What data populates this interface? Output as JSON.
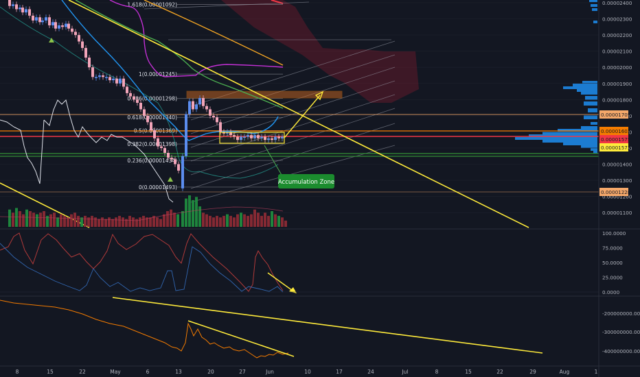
{
  "chart_data": [
    {
      "type": "candlestick",
      "title": "",
      "price_axis": {
        "ticks": [
          "0.00002400",
          "0.00002300",
          "0.00002200",
          "0.00002100",
          "0.00002000",
          "0.00001900",
          "0.00001800",
          "0.00001700",
          "0.00001600",
          "0.00001500",
          "0.00001400",
          "0.00001300",
          "0.00001200",
          "0.00001100"
        ],
        "range": [
          1.06e-05,
          2.41e-05
        ]
      },
      "price_tags": [
        {
          "value": "0.00001705",
          "price": 1.705e-05,
          "bg": "#f5a86a"
        },
        {
          "value": "0.00001602",
          "price": 1.602e-05,
          "bg": "#f57c00"
        },
        {
          "value": "0.00001575",
          "price": 1.575e-05,
          "bg": "#f23645"
        },
        {
          "value": "0.00001573",
          "price": 1.573e-05,
          "bg": "#ffeb3b"
        },
        {
          "value": "0.00001228",
          "price": 1.228e-05,
          "bg": "#f5a86a"
        }
      ],
      "fib_levels": [
        {
          "label": "1.618(0.00001092)",
          "ratio": 1.618,
          "price": 2.39e-05
        },
        {
          "label": "1(0.00001245)",
          "ratio": 1,
          "price": 1.958e-05
        },
        {
          "label": "0.786(0.00001298)",
          "ratio": 0.786,
          "price": 1.808e-05
        },
        {
          "label": "0.618(0.00001340)",
          "ratio": 0.618,
          "price": 1.69e-05
        },
        {
          "label": "0.5(0.00001369)",
          "ratio": 0.5,
          "price": 1.608e-05
        },
        {
          "label": "0.382(0.00001398)",
          "ratio": 0.382,
          "price": 1.525e-05
        },
        {
          "label": "0.236(0.00001434)",
          "ratio": 0.236,
          "price": 1.423e-05
        },
        {
          "label": "0(0.00001493)",
          "ratio": 0,
          "price": 1.258e-05
        }
      ],
      "annotations": [
        "Accumulation Zone"
      ],
      "candles": [
        {
          "x": 14,
          "o": 2.42e-05,
          "c": 2.38e-05
        },
        {
          "x": 19,
          "o": 2.38e-05,
          "c": 2.39e-05
        },
        {
          "x": 24,
          "o": 2.39e-05,
          "c": 2.36e-05
        },
        {
          "x": 29,
          "o": 2.36e-05,
          "c": 2.37e-05
        },
        {
          "x": 33,
          "o": 2.37e-05,
          "c": 2.34e-05
        },
        {
          "x": 38,
          "o": 2.34e-05,
          "c": 2.36e-05
        },
        {
          "x": 43,
          "o": 2.36e-05,
          "c": 2.32e-05
        },
        {
          "x": 48,
          "o": 2.32e-05,
          "c": 2.29e-05
        },
        {
          "x": 53,
          "o": 2.29e-05,
          "c": 2.31e-05
        },
        {
          "x": 58,
          "o": 2.31e-05,
          "c": 2.28e-05
        },
        {
          "x": 62,
          "o": 2.28e-05,
          "c": 2.29e-05
        },
        {
          "x": 67,
          "o": 2.29e-05,
          "c": 2.31e-05
        },
        {
          "x": 72,
          "o": 2.31e-05,
          "c": 2.26e-05
        },
        {
          "x": 77,
          "o": 2.26e-05,
          "c": 2.28e-05
        },
        {
          "x": 81,
          "o": 2.28e-05,
          "c": 2.24e-05
        },
        {
          "x": 86,
          "o": 2.24e-05,
          "c": 2.26e-05
        },
        {
          "x": 91,
          "o": 2.26e-05,
          "c": 2.25e-05
        },
        {
          "x": 96,
          "o": 2.25e-05,
          "c": 2.27e-05
        },
        {
          "x": 100,
          "o": 2.27e-05,
          "c": 2.24e-05
        },
        {
          "x": 105,
          "o": 2.24e-05,
          "c": 2.22e-05
        },
        {
          "x": 110,
          "o": 2.22e-05,
          "c": 2.2e-05
        },
        {
          "x": 115,
          "o": 2.2e-05,
          "c": 2.16e-05
        },
        {
          "x": 120,
          "o": 2.16e-05,
          "c": 2.12e-05
        },
        {
          "x": 125,
          "o": 2.12e-05,
          "c": 2.06e-05
        },
        {
          "x": 130,
          "o": 2.06e-05,
          "c": 2e-05
        },
        {
          "x": 135,
          "o": 2e-05,
          "c": 1.94e-05
        },
        {
          "x": 140,
          "o": 1.94e-05,
          "c": 1.94e-05
        },
        {
          "x": 145,
          "o": 1.94e-05,
          "c": 1.95e-05
        },
        {
          "x": 150,
          "o": 1.95e-05,
          "c": 1.94e-05
        },
        {
          "x": 155,
          "o": 1.94e-05,
          "c": 1.94e-05
        },
        {
          "x": 160,
          "o": 1.94e-05,
          "c": 1.92e-05
        },
        {
          "x": 165,
          "o": 1.92e-05,
          "c": 1.93e-05
        },
        {
          "x": 170,
          "o": 1.93e-05,
          "c": 1.9e-05
        },
        {
          "x": 175,
          "o": 1.9e-05,
          "c": 1.93e-05
        },
        {
          "x": 180,
          "o": 1.93e-05,
          "c": 1.88e-05
        },
        {
          "x": 185,
          "o": 1.88e-05,
          "c": 1.84e-05
        },
        {
          "x": 190,
          "o": 1.84e-05,
          "c": 1.82e-05
        },
        {
          "x": 195,
          "o": 1.82e-05,
          "c": 1.8e-05
        },
        {
          "x": 200,
          "o": 1.8e-05,
          "c": 1.78e-05
        },
        {
          "x": 205,
          "o": 1.78e-05,
          "c": 1.74e-05
        },
        {
          "x": 210,
          "o": 1.74e-05,
          "c": 1.7e-05
        },
        {
          "x": 215,
          "o": 1.7e-05,
          "c": 1.66e-05
        },
        {
          "x": 220,
          "o": 1.66e-05,
          "c": 1.61e-05
        },
        {
          "x": 225,
          "o": 1.61e-05,
          "c": 1.56e-05
        },
        {
          "x": 230,
          "o": 1.56e-05,
          "c": 1.51e-05
        },
        {
          "x": 235,
          "o": 1.51e-05,
          "c": 1.5e-05
        },
        {
          "x": 240,
          "o": 1.5e-05,
          "c": 1.47e-05
        },
        {
          "x": 245,
          "o": 1.47e-05,
          "c": 1.44e-05
        },
        {
          "x": 250,
          "o": 1.44e-05,
          "c": 1.43e-05
        },
        {
          "x": 255,
          "o": 1.43e-05,
          "c": 1.4e-05
        },
        {
          "x": 260,
          "o": 1.4e-05,
          "c": 1.36e-05
        },
        {
          "x": 266,
          "o": 1.25e-05,
          "c": 1.45e-05
        },
        {
          "x": 271,
          "o": 1.45e-05,
          "c": 1.71e-05
        },
        {
          "x": 276,
          "o": 1.71e-05,
          "c": 1.79e-05
        },
        {
          "x": 281,
          "o": 1.79e-05,
          "c": 1.74e-05
        },
        {
          "x": 286,
          "o": 1.74e-05,
          "c": 1.77e-05
        },
        {
          "x": 291,
          "o": 1.77e-05,
          "c": 1.81e-05
        },
        {
          "x": 296,
          "o": 1.81e-05,
          "c": 1.76e-05
        },
        {
          "x": 301,
          "o": 1.76e-05,
          "c": 1.74e-05
        },
        {
          "x": 306,
          "o": 1.74e-05,
          "c": 1.7e-05
        },
        {
          "x": 311,
          "o": 1.7e-05,
          "c": 1.69e-05
        },
        {
          "x": 316,
          "o": 1.69e-05,
          "c": 1.66e-05
        },
        {
          "x": 321,
          "o": 1.66e-05,
          "c": 1.6e-05
        },
        {
          "x": 326,
          "o": 1.6e-05,
          "c": 1.59e-05
        },
        {
          "x": 331,
          "o": 1.59e-05,
          "c": 1.6e-05
        },
        {
          "x": 336,
          "o": 1.6e-05,
          "c": 1.58e-05
        },
        {
          "x": 341,
          "o": 1.58e-05,
          "c": 1.57e-05
        },
        {
          "x": 346,
          "o": 1.57e-05,
          "c": 1.55e-05
        },
        {
          "x": 351,
          "o": 1.55e-05,
          "c": 1.57e-05
        },
        {
          "x": 356,
          "o": 1.57e-05,
          "c": 1.57e-05
        },
        {
          "x": 361,
          "o": 1.57e-05,
          "c": 1.58e-05
        },
        {
          "x": 366,
          "o": 1.58e-05,
          "c": 1.56e-05
        },
        {
          "x": 371,
          "o": 1.56e-05,
          "c": 1.58e-05
        },
        {
          "x": 376,
          "o": 1.58e-05,
          "c": 1.56e-05
        },
        {
          "x": 381,
          "o": 1.56e-05,
          "c": 1.57e-05
        },
        {
          "x": 386,
          "o": 1.57e-05,
          "c": 1.55e-05
        },
        {
          "x": 391,
          "o": 1.55e-05,
          "c": 1.56e-05
        },
        {
          "x": 396,
          "o": 1.56e-05,
          "c": 1.55e-05
        },
        {
          "x": 401,
          "o": 1.55e-05,
          "c": 1.57e-05
        },
        {
          "x": 406,
          "o": 1.57e-05,
          "c": 1.56e-05
        },
        {
          "x": 411,
          "o": 1.56e-05,
          "c": 1.57e-05
        }
      ],
      "volumes": [
        {
          "x": 14,
          "v": 0.55,
          "up": true
        },
        {
          "x": 19,
          "v": 0.45,
          "up": false
        },
        {
          "x": 24,
          "v": 0.6,
          "up": true
        },
        {
          "x": 29,
          "v": 0.5,
          "up": false
        },
        {
          "x": 34,
          "v": 0.4,
          "up": false
        },
        {
          "x": 39,
          "v": 0.55,
          "up": true
        },
        {
          "x": 44,
          "v": 0.5,
          "up": false
        },
        {
          "x": 49,
          "v": 0.45,
          "up": false
        },
        {
          "x": 54,
          "v": 0.4,
          "up": true
        },
        {
          "x": 59,
          "v": 0.45,
          "up": false
        },
        {
          "x": 64,
          "v": 0.5,
          "up": false
        },
        {
          "x": 69,
          "v": 0.35,
          "up": true
        },
        {
          "x": 74,
          "v": 0.4,
          "up": false
        },
        {
          "x": 79,
          "v": 0.45,
          "up": false
        },
        {
          "x": 84,
          "v": 0.3,
          "up": true
        },
        {
          "x": 89,
          "v": 0.4,
          "up": false
        },
        {
          "x": 94,
          "v": 0.35,
          "up": false
        },
        {
          "x": 99,
          "v": 0.3,
          "up": false
        },
        {
          "x": 104,
          "v": 0.4,
          "up": false
        },
        {
          "x": 109,
          "v": 0.45,
          "up": false
        },
        {
          "x": 114,
          "v": 0.35,
          "up": false
        },
        {
          "x": 119,
          "v": 0.3,
          "up": true
        },
        {
          "x": 124,
          "v": 0.35,
          "up": false
        },
        {
          "x": 129,
          "v": 0.3,
          "up": false
        },
        {
          "x": 134,
          "v": 0.35,
          "up": false
        },
        {
          "x": 139,
          "v": 0.3,
          "up": false
        },
        {
          "x": 144,
          "v": 0.25,
          "up": false
        },
        {
          "x": 149,
          "v": 0.3,
          "up": false
        },
        {
          "x": 154,
          "v": 0.25,
          "up": false
        },
        {
          "x": 159,
          "v": 0.3,
          "up": false
        },
        {
          "x": 164,
          "v": 0.25,
          "up": false
        },
        {
          "x": 169,
          "v": 0.3,
          "up": false
        },
        {
          "x": 174,
          "v": 0.35,
          "up": false
        },
        {
          "x": 179,
          "v": 0.3,
          "up": false
        },
        {
          "x": 184,
          "v": 0.25,
          "up": false
        },
        {
          "x": 189,
          "v": 0.35,
          "up": false
        },
        {
          "x": 194,
          "v": 0.3,
          "up": false
        },
        {
          "x": 199,
          "v": 0.25,
          "up": false
        },
        {
          "x": 204,
          "v": 0.3,
          "up": false
        },
        {
          "x": 209,
          "v": 0.35,
          "up": false
        },
        {
          "x": 214,
          "v": 0.3,
          "up": false
        },
        {
          "x": 219,
          "v": 0.3,
          "up": false
        },
        {
          "x": 224,
          "v": 0.35,
          "up": false
        },
        {
          "x": 229,
          "v": 0.3,
          "up": false
        },
        {
          "x": 234,
          "v": 0.25,
          "up": false
        },
        {
          "x": 239,
          "v": 0.4,
          "up": false
        },
        {
          "x": 244,
          "v": 0.5,
          "up": false
        },
        {
          "x": 249,
          "v": 0.55,
          "up": false
        },
        {
          "x": 254,
          "v": 0.45,
          "up": false
        },
        {
          "x": 259,
          "v": 0.4,
          "up": true
        },
        {
          "x": 266,
          "v": 0.5,
          "up": true
        },
        {
          "x": 271,
          "v": 0.9,
          "up": true
        },
        {
          "x": 276,
          "v": 1.0,
          "up": true
        },
        {
          "x": 281,
          "v": 0.85,
          "up": true
        },
        {
          "x": 286,
          "v": 0.95,
          "up": true
        },
        {
          "x": 291,
          "v": 0.65,
          "up": true
        },
        {
          "x": 296,
          "v": 0.45,
          "up": false
        },
        {
          "x": 301,
          "v": 0.4,
          "up": false
        },
        {
          "x": 306,
          "v": 0.35,
          "up": false
        },
        {
          "x": 311,
          "v": 0.3,
          "up": false
        },
        {
          "x": 316,
          "v": 0.35,
          "up": false
        },
        {
          "x": 321,
          "v": 0.3,
          "up": false
        },
        {
          "x": 326,
          "v": 0.35,
          "up": false
        },
        {
          "x": 331,
          "v": 0.4,
          "up": true
        },
        {
          "x": 336,
          "v": 0.35,
          "up": false
        },
        {
          "x": 341,
          "v": 0.3,
          "up": false
        },
        {
          "x": 346,
          "v": 0.4,
          "up": false
        },
        {
          "x": 351,
          "v": 0.45,
          "up": true
        },
        {
          "x": 356,
          "v": 0.4,
          "up": false
        },
        {
          "x": 361,
          "v": 0.35,
          "up": false
        },
        {
          "x": 366,
          "v": 0.4,
          "up": false
        },
        {
          "x": 371,
          "v": 0.55,
          "up": false
        },
        {
          "x": 376,
          "v": 0.45,
          "up": false
        },
        {
          "x": 381,
          "v": 0.35,
          "up": false
        },
        {
          "x": 386,
          "v": 0.45,
          "up": false
        },
        {
          "x": 391,
          "v": 0.35,
          "up": false
        },
        {
          "x": 396,
          "v": 0.5,
          "up": true
        },
        {
          "x": 401,
          "v": 0.4,
          "up": false
        },
        {
          "x": 406,
          "v": 0.35,
          "up": true
        },
        {
          "x": 411,
          "v": 0.3,
          "up": false
        },
        {
          "x": 416,
          "v": 0.2,
          "up": false
        }
      ]
    },
    {
      "type": "line",
      "title": "",
      "y_ticks": [
        "100.0000",
        "75.0000",
        "50.0000",
        "25.0000",
        "0.0000"
      ],
      "ylim": [
        0,
        100
      ]
    },
    {
      "type": "line",
      "title": "",
      "y_ticks": [
        "-200000000.0000",
        "-300000000.0000",
        "-400000000.0000"
      ]
    }
  ],
  "time_axis": {
    "labels": [
      "8",
      "15",
      "22",
      "May",
      "6",
      "13",
      "20",
      "27",
      "Jun",
      "10",
      "17",
      "24",
      "Jul",
      "8",
      "15",
      "22",
      "29",
      "Aug",
      "1"
    ]
  }
}
